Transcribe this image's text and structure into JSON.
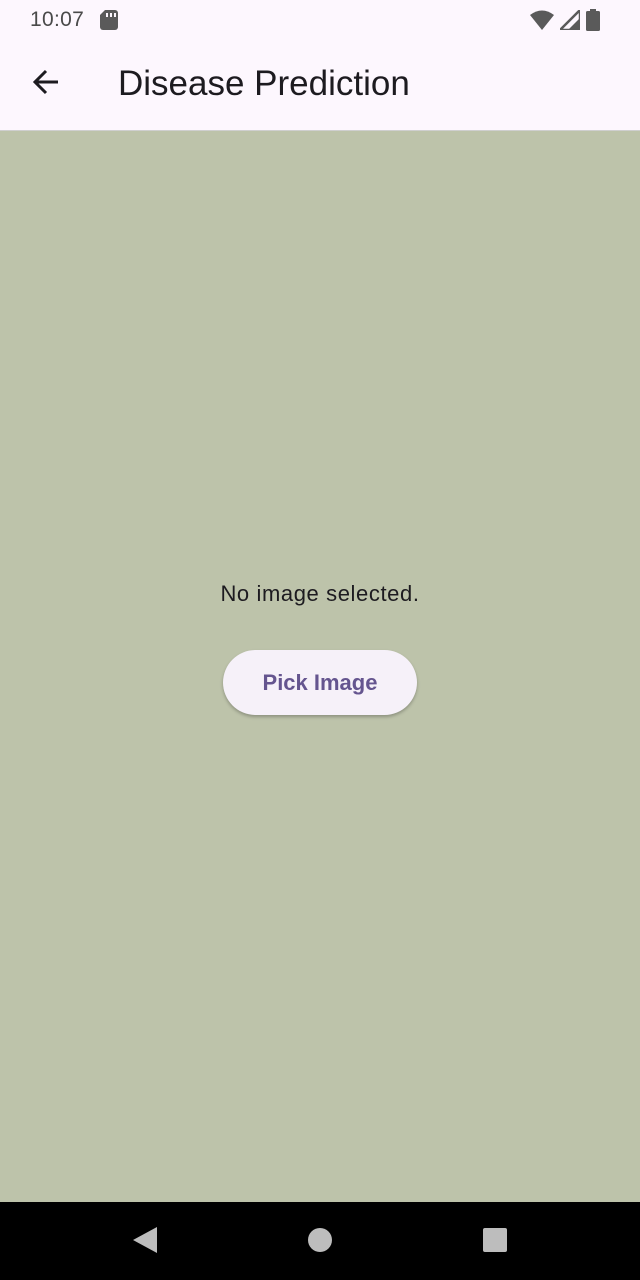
{
  "status_bar": {
    "time": "10:07",
    "icons": [
      "sd-card-icon",
      "wifi-icon",
      "cell-signal-icon",
      "battery-icon"
    ]
  },
  "app_bar": {
    "back_icon": "arrow-back-icon",
    "title": "Disease Prediction"
  },
  "main": {
    "status_text": "No image selected.",
    "pick_button_label": "Pick Image"
  },
  "nav_bar": {
    "buttons": [
      "back-triangle-icon",
      "home-circle-icon",
      "recents-square-icon"
    ]
  },
  "colors": {
    "background": "#bdc3aa",
    "app_bar": "#fdf7fe",
    "accent": "#65558f",
    "button_bg": "#f6f1f9"
  }
}
